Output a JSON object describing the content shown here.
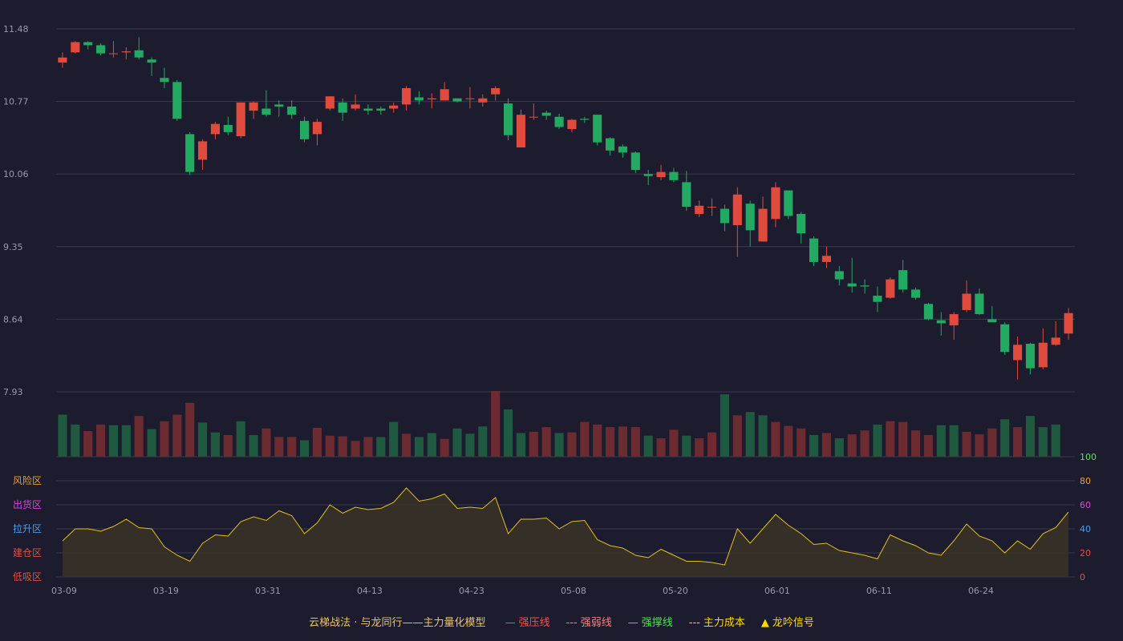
{
  "chart_data": {
    "type": "candlestick",
    "price_axis": {
      "ticks": [
        "11.48",
        "10.77",
        "10.06",
        "9.35",
        "8.64",
        "7.93"
      ],
      "range": [
        7.93,
        11.48
      ]
    },
    "x_axis": {
      "ticks": [
        "03-09",
        "03-19",
        "03-31",
        "04-13",
        "04-23",
        "05-08",
        "05-20",
        "06-01",
        "06-11",
        "06-24"
      ],
      "tick_index": [
        0,
        8,
        16,
        24,
        32,
        40,
        48,
        56,
        64,
        72
      ]
    },
    "candles": [
      [
        11.15,
        11.2,
        11.25,
        11.1
      ],
      [
        11.25,
        11.35,
        11.36,
        11.24
      ],
      [
        11.35,
        11.32,
        11.36,
        11.28
      ],
      [
        11.32,
        11.24,
        11.34,
        11.22
      ],
      [
        11.24,
        11.24,
        11.36,
        11.2
      ],
      [
        11.25,
        11.26,
        11.3,
        11.18
      ],
      [
        11.27,
        11.2,
        11.4,
        11.18
      ],
      [
        11.18,
        11.15,
        11.2,
        11.02
      ],
      [
        11.0,
        10.96,
        11.1,
        10.9
      ],
      [
        10.96,
        10.6,
        10.98,
        10.58
      ],
      [
        10.45,
        10.08,
        10.47,
        10.05
      ],
      [
        10.2,
        10.38,
        10.4,
        10.1
      ],
      [
        10.45,
        10.55,
        10.57,
        10.4
      ],
      [
        10.54,
        10.47,
        10.62,
        10.44
      ],
      [
        10.43,
        10.76,
        10.76,
        10.41
      ],
      [
        10.68,
        10.76,
        10.77,
        10.6
      ],
      [
        10.7,
        10.64,
        10.88,
        10.62
      ],
      [
        10.74,
        10.72,
        10.78,
        10.62
      ],
      [
        10.72,
        10.64,
        10.78,
        10.6
      ],
      [
        10.58,
        10.4,
        10.62,
        10.37
      ],
      [
        10.45,
        10.57,
        10.6,
        10.34
      ],
      [
        10.7,
        10.82,
        10.82,
        10.68
      ],
      [
        10.76,
        10.66,
        10.8,
        10.58
      ],
      [
        10.7,
        10.74,
        10.84,
        10.68
      ],
      [
        10.7,
        10.68,
        10.74,
        10.64
      ],
      [
        10.7,
        10.68,
        10.72,
        10.64
      ],
      [
        10.7,
        10.73,
        10.76,
        10.66
      ],
      [
        10.74,
        10.9,
        10.92,
        10.68
      ],
      [
        10.81,
        10.78,
        10.87,
        10.74
      ],
      [
        10.79,
        10.8,
        10.85,
        10.7
      ],
      [
        10.78,
        10.89,
        10.96,
        10.78
      ],
      [
        10.8,
        10.77,
        10.8,
        10.76
      ],
      [
        10.8,
        10.8,
        10.91,
        10.7
      ],
      [
        10.76,
        10.8,
        10.84,
        10.72
      ],
      [
        10.84,
        10.9,
        10.92,
        10.78
      ],
      [
        10.75,
        10.44,
        10.8,
        10.39
      ],
      [
        10.32,
        10.64,
        10.69,
        10.33
      ],
      [
        10.62,
        10.62,
        10.75,
        10.59
      ],
      [
        10.66,
        10.63,
        10.68,
        10.59
      ],
      [
        10.62,
        10.52,
        10.65,
        10.5
      ],
      [
        10.5,
        10.59,
        10.6,
        10.47
      ],
      [
        10.6,
        10.59,
        10.62,
        10.56
      ],
      [
        10.64,
        10.37,
        10.64,
        10.34
      ],
      [
        10.41,
        10.29,
        10.42,
        10.24
      ],
      [
        10.33,
        10.27,
        10.35,
        10.22
      ],
      [
        10.27,
        10.1,
        10.28,
        10.07
      ],
      [
        10.06,
        10.04,
        10.1,
        9.95
      ],
      [
        10.03,
        10.08,
        10.15,
        10.0
      ],
      [
        10.08,
        10.0,
        10.12,
        9.98
      ],
      [
        9.98,
        9.74,
        10.09,
        9.7
      ],
      [
        9.67,
        9.75,
        9.8,
        9.64
      ],
      [
        9.74,
        9.74,
        9.82,
        9.65
      ],
      [
        9.72,
        9.58,
        9.76,
        9.5
      ],
      [
        9.56,
        9.86,
        9.93,
        9.25
      ],
      [
        9.77,
        9.51,
        9.8,
        9.35
      ],
      [
        9.4,
        9.72,
        9.84,
        9.4
      ],
      [
        9.62,
        9.93,
        9.98,
        9.54
      ],
      [
        9.9,
        9.65,
        9.9,
        9.62
      ],
      [
        9.67,
        9.48,
        9.69,
        9.38
      ],
      [
        9.43,
        9.2,
        9.45,
        9.16
      ],
      [
        9.2,
        9.26,
        9.35,
        9.14
      ],
      [
        9.11,
        9.03,
        9.16,
        8.97
      ],
      [
        8.99,
        8.96,
        9.24,
        8.9
      ],
      [
        8.97,
        8.96,
        9.03,
        8.89
      ],
      [
        8.87,
        8.81,
        8.96,
        8.71
      ],
      [
        8.85,
        9.03,
        9.05,
        8.84
      ],
      [
        9.12,
        8.93,
        9.22,
        8.9
      ],
      [
        8.93,
        8.85,
        8.95,
        8.83
      ],
      [
        8.79,
        8.64,
        8.8,
        8.63
      ],
      [
        8.63,
        8.6,
        8.71,
        8.48
      ],
      [
        8.58,
        8.69,
        8.71,
        8.44
      ],
      [
        8.73,
        8.89,
        9.02,
        8.71
      ],
      [
        8.89,
        8.69,
        8.94,
        8.68
      ],
      [
        8.64,
        8.61,
        8.77,
        8.61
      ],
      [
        8.59,
        8.32,
        8.61,
        8.29
      ],
      [
        8.24,
        8.39,
        8.47,
        8.05
      ],
      [
        8.4,
        8.16,
        8.41,
        8.1
      ],
      [
        8.17,
        8.41,
        8.55,
        8.15
      ],
      [
        8.39,
        8.46,
        8.62,
        8.38
      ],
      [
        8.5,
        8.7,
        8.75,
        8.44
      ]
    ],
    "volume": [
      [
        0.64,
        "d"
      ],
      [
        0.49,
        "d"
      ],
      [
        0.39,
        "u"
      ],
      [
        0.49,
        "u"
      ],
      [
        0.48,
        "d"
      ],
      [
        0.48,
        "d"
      ],
      [
        0.62,
        "u"
      ],
      [
        0.42,
        "d"
      ],
      [
        0.54,
        "u"
      ],
      [
        0.64,
        "u"
      ],
      [
        0.82,
        "u"
      ],
      [
        0.52,
        "d"
      ],
      [
        0.37,
        "d"
      ],
      [
        0.33,
        "u"
      ],
      [
        0.54,
        "d"
      ],
      [
        0.33,
        "d"
      ],
      [
        0.43,
        "u"
      ],
      [
        0.3,
        "u"
      ],
      [
        0.3,
        "u"
      ],
      [
        0.25,
        "d"
      ],
      [
        0.44,
        "u"
      ],
      [
        0.32,
        "u"
      ],
      [
        0.31,
        "u"
      ],
      [
        0.24,
        "u"
      ],
      [
        0.3,
        "u"
      ],
      [
        0.3,
        "d"
      ],
      [
        0.53,
        "d"
      ],
      [
        0.35,
        "u"
      ],
      [
        0.3,
        "d"
      ],
      [
        0.36,
        "d"
      ],
      [
        0.27,
        "u"
      ],
      [
        0.43,
        "d"
      ],
      [
        0.35,
        "d"
      ],
      [
        0.46,
        "d"
      ],
      [
        1.0,
        "u"
      ],
      [
        0.72,
        "d"
      ],
      [
        0.36,
        "d"
      ],
      [
        0.38,
        "u"
      ],
      [
        0.45,
        "u"
      ],
      [
        0.36,
        "d"
      ],
      [
        0.37,
        "u"
      ],
      [
        0.53,
        "u"
      ],
      [
        0.49,
        "u"
      ],
      [
        0.45,
        "u"
      ],
      [
        0.46,
        "u"
      ],
      [
        0.45,
        "u"
      ],
      [
        0.32,
        "d"
      ],
      [
        0.28,
        "u"
      ],
      [
        0.41,
        "u"
      ],
      [
        0.32,
        "d"
      ],
      [
        0.28,
        "u"
      ],
      [
        0.37,
        "u"
      ],
      [
        0.95,
        "d"
      ],
      [
        0.63,
        "u"
      ],
      [
        0.68,
        "d"
      ],
      [
        0.63,
        "d"
      ],
      [
        0.53,
        "u"
      ],
      [
        0.47,
        "u"
      ],
      [
        0.43,
        "u"
      ],
      [
        0.33,
        "d"
      ],
      [
        0.36,
        "u"
      ],
      [
        0.28,
        "d"
      ],
      [
        0.34,
        "u"
      ],
      [
        0.4,
        "u"
      ],
      [
        0.49,
        "d"
      ],
      [
        0.54,
        "u"
      ],
      [
        0.53,
        "u"
      ],
      [
        0.4,
        "u"
      ],
      [
        0.33,
        "u"
      ],
      [
        0.48,
        "d"
      ],
      [
        0.48,
        "d"
      ],
      [
        0.38,
        "u"
      ],
      [
        0.34,
        "u"
      ],
      [
        0.43,
        "u"
      ],
      [
        0.57,
        "d"
      ],
      [
        0.45,
        "u"
      ],
      [
        0.62,
        "d"
      ],
      [
        0.45,
        "d"
      ],
      [
        0.49,
        "d"
      ]
    ],
    "indicator": {
      "name": "主力量化模型",
      "y_range": [
        0,
        100
      ],
      "ticks": [
        "0",
        "20",
        "40",
        "60",
        "80",
        "100"
      ],
      "tick_colors": [
        "#e05040",
        "#e05040",
        "#4a9ef0",
        "#e040e0",
        "#e8a030",
        "#60e060"
      ],
      "zones": [
        {
          "label": "风险区",
          "color": "#e8a030",
          "level": 80
        },
        {
          "label": "出货区",
          "color": "#e040e0",
          "level": 60
        },
        {
          "label": "拉升区",
          "color": "#4a9ef0",
          "level": 40
        },
        {
          "label": "建仓区",
          "color": "#e05040",
          "level": 20
        },
        {
          "label": "低吸区",
          "color": "#e05040",
          "level": 0
        }
      ],
      "values": [
        30,
        40,
        40,
        38,
        42,
        48,
        41,
        40,
        25,
        18,
        13,
        28,
        35,
        34,
        46,
        50,
        47,
        55,
        51,
        36,
        45,
        60,
        53,
        58,
        56,
        57,
        62,
        74,
        63,
        65,
        69,
        57,
        58,
        57,
        66,
        36,
        48,
        48,
        49,
        40,
        46,
        47,
        31,
        26,
        24,
        18,
        16,
        23,
        18,
        13,
        13,
        12,
        10,
        40,
        28,
        40,
        52,
        43,
        36,
        27,
        28,
        22,
        20,
        18,
        15,
        35,
        30,
        26,
        20,
        18,
        30,
        44,
        34,
        30,
        20,
        30,
        23,
        36,
        41,
        54
      ]
    }
  },
  "legend": {
    "title": "云梯战法 · 与龙同行——主力量化模型",
    "items": [
      {
        "label": "强压线",
        "color": "#ff4c4c",
        "symbol": "—"
      },
      {
        "label": "强弱线",
        "color": "#ff7f7f",
        "symbol": "---"
      },
      {
        "label": "强撑线",
        "color": "#40ee40",
        "symbol": "—"
      },
      {
        "label": "主力成本",
        "color": "#ffd700",
        "symbol": "---"
      },
      {
        "label": "龙吟信号",
        "color": "#ffd700",
        "symbol": "▲"
      }
    ]
  },
  "colors": {
    "up": "#e04b3e",
    "down": "#22aa62",
    "vol_up": "#6b2b30",
    "vol_down": "#1f5a40",
    "grid": "#3a3a4c",
    "line": "#e0c020",
    "area": "#3a3226"
  }
}
